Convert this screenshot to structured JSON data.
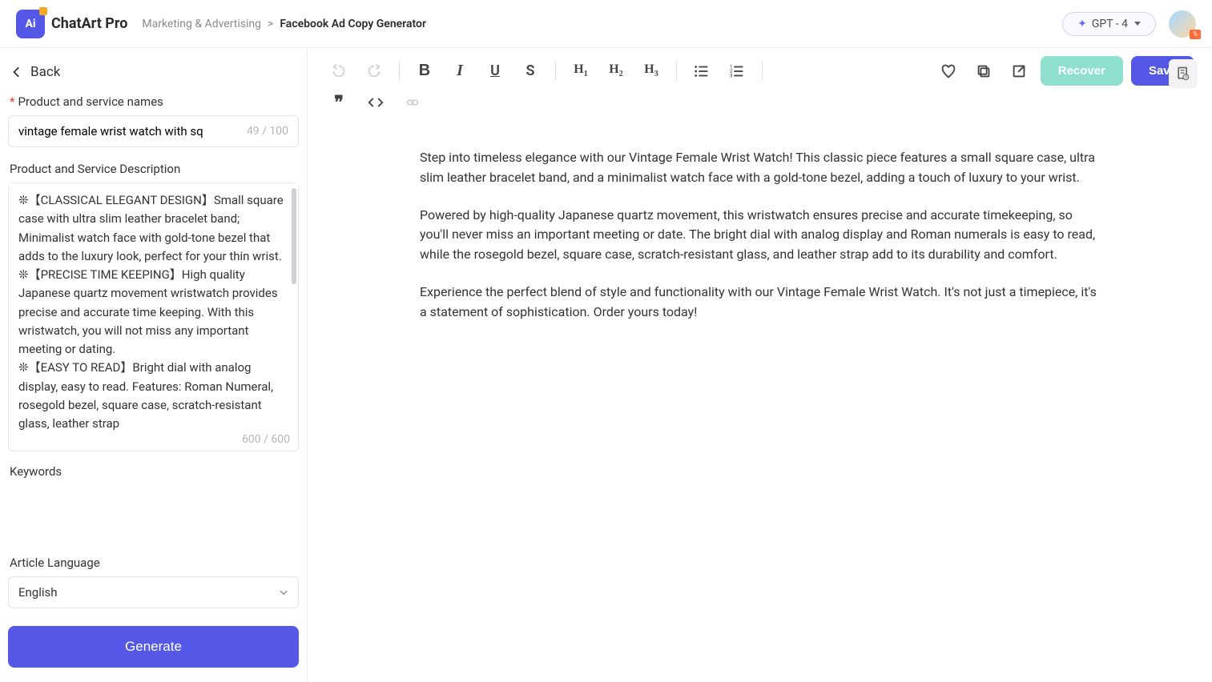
{
  "header": {
    "brand": "ChatArt Pro",
    "logo_text": "Ai",
    "breadcrumb_category": "Marketing & Advertising",
    "breadcrumb_sep": ">",
    "breadcrumb_current": "Facebook Ad Copy Generator",
    "model_label": "GPT - 4",
    "avatar_badge": "%"
  },
  "sidebar": {
    "back_label": "Back",
    "field1_label": "Product and service names",
    "field1_value": "vintage female wrist watch with sq",
    "field1_counter": "49 / 100",
    "field2_label": "Product and Service Description",
    "field2_value": "❊【CLASSICAL ELEGANT DESIGN】Small square case with ultra slim leather bracelet band; Minimalist watch face with gold-tone bezel that adds to the luxury look, perfect for your thin wrist.\n❊【PRECISE TIME KEEPING】High quality Japanese quartz movement wristwatch provides precise and accurate time keeping. With this wristwatch, you will not miss any important meeting or dating.\n❊【EASY TO READ】Bright dial with analog display, easy to read. Features: Roman Numeral, rosegold bezel, square case, scratch-resistant glass, leather strap",
    "field2_counter": "600 / 600",
    "keywords_label": "Keywords",
    "lang_label": "Article Language",
    "lang_value": "English",
    "generate_label": "Generate"
  },
  "toolbar": {
    "recover": "Recover",
    "save": "Save"
  },
  "content": {
    "p1": "Step into timeless elegance with our Vintage Female Wrist Watch! This classic piece features a small square case, ultra slim leather bracelet band, and a minimalist watch face with a gold-tone bezel, adding a touch of luxury to your wrist.",
    "p2": "Powered by high-quality Japanese quartz movement, this wristwatch ensures precise and accurate timekeeping, so you'll never miss an important meeting or date. The bright dial with analog display and Roman numerals is easy to read, while the rosegold bezel, square case, scratch-resistant glass, and leather strap add to its durability and comfort.",
    "p3": "Experience the perfect blend of style and functionality with our Vintage Female Wrist Watch. It's not just a timepiece, it's a statement of sophistication. Order yours today!"
  }
}
